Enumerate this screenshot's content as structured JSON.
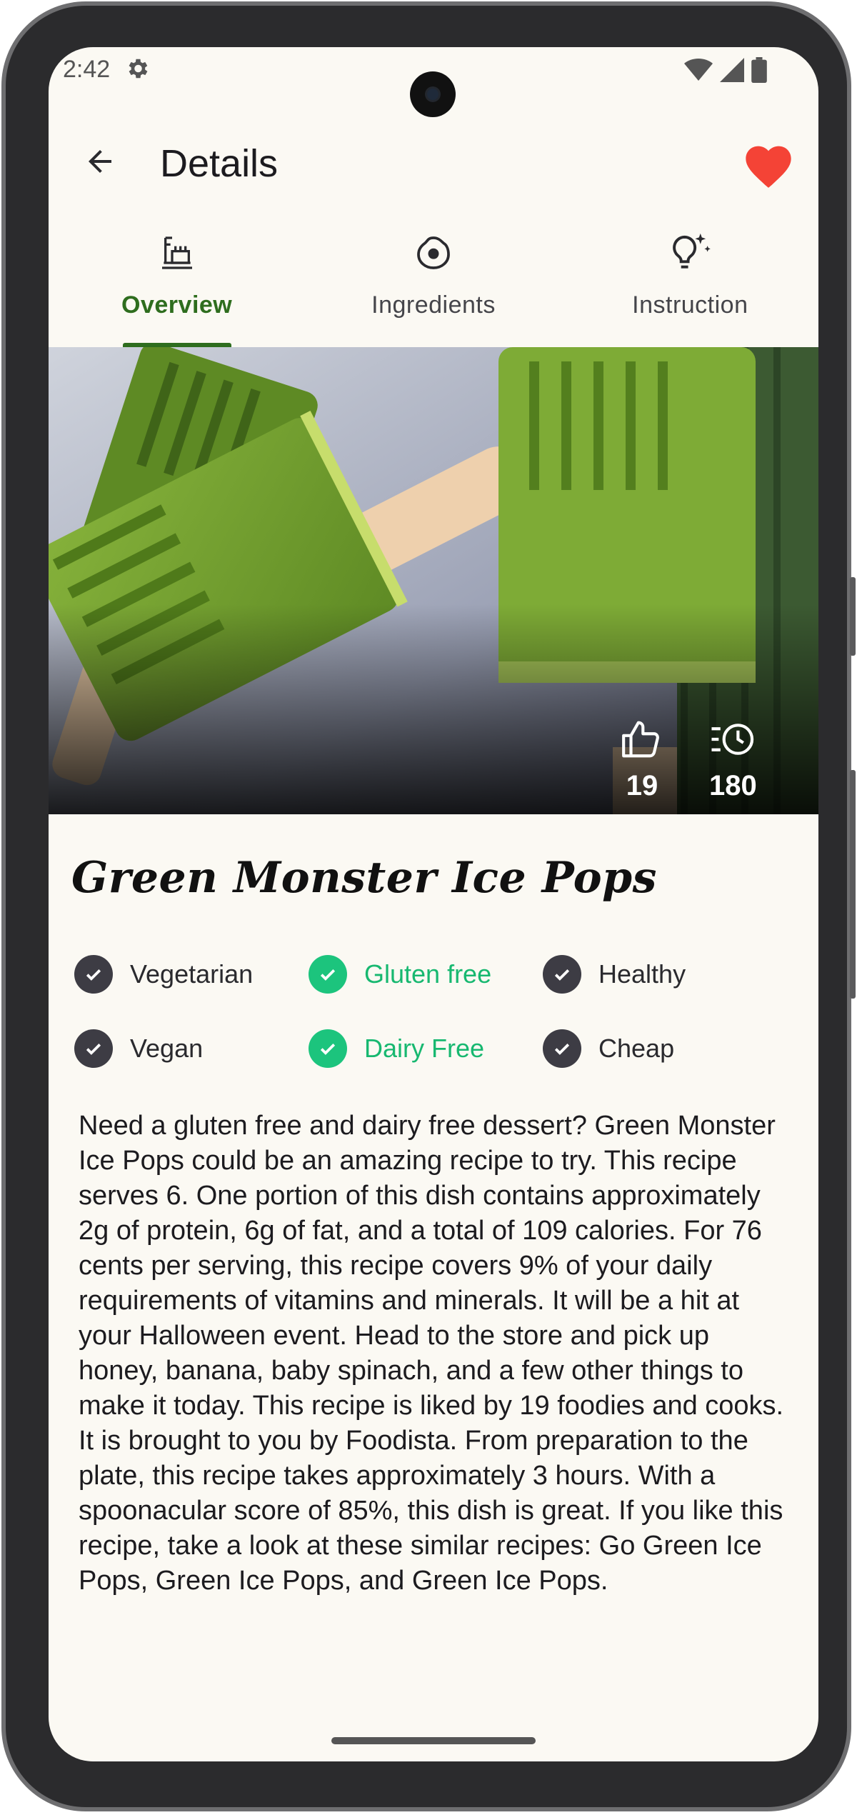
{
  "status_bar": {
    "time": "2:42",
    "icons": [
      "settings-gear-icon",
      "wifi-icon",
      "cellular-signal-icon",
      "battery-icon"
    ]
  },
  "app_bar": {
    "title": "Details",
    "back_icon": "arrow-back-icon",
    "favorite_icon": "heart-icon",
    "favorite_color": "#f44336"
  },
  "tabs": [
    {
      "label": "Overview",
      "icon": "recipe-overview-icon",
      "active": true
    },
    {
      "label": "Ingredients",
      "icon": "egg-icon",
      "active": false
    },
    {
      "label": "Instruction",
      "icon": "lightbulb-icon",
      "active": false
    }
  ],
  "accent_color": "#2e6d1e",
  "hero": {
    "likes_icon": "thumb-up-icon",
    "likes": "19",
    "time_icon": "timer-icon",
    "time": "180"
  },
  "recipe": {
    "title": "Green Monster Ice Pops",
    "badges": [
      {
        "label": "Vegetarian",
        "active": false
      },
      {
        "label": "Gluten free",
        "active": true
      },
      {
        "label": "Healthy",
        "active": false
      },
      {
        "label": "Vegan",
        "active": false
      },
      {
        "label": "Dairy Free",
        "active": true
      },
      {
        "label": "Cheap",
        "active": false
      }
    ],
    "active_badge_color": "#1cc47d",
    "summary": "Need a gluten free and dairy free dessert? Green Monster Ice Pops could be an amazing recipe to try. This recipe serves 6. One portion of this dish contains approximately 2g of protein, 6g of fat, and a total of 109 calories. For 76 cents per serving, this recipe covers 9% of your daily requirements of vitamins and minerals. It will be a hit at your Halloween event. Head to the store and pick up honey, banana, baby spinach, and a few other things to make it today. This recipe is liked by 19 foodies and cooks. It is brought to you by Foodista. From preparation to the plate, this recipe takes approximately 3 hours. With a spoonacular score of 85%, this dish is great. If you like this recipe, take a look at these similar recipes: Go Green Ice Pops, Green Ice Pops, and Green Ice Pops."
  }
}
